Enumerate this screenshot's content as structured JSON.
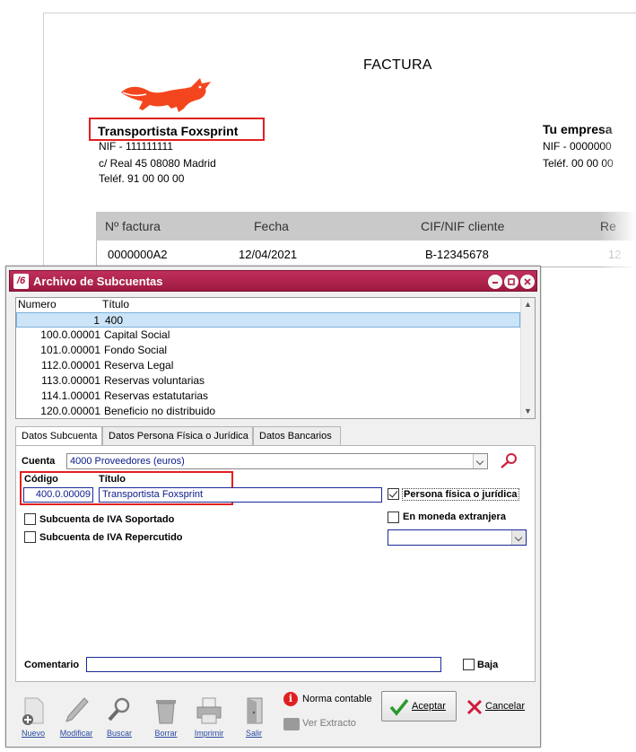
{
  "invoice": {
    "title": "FACTURA",
    "issuer": {
      "name": "Transportista Foxsprint",
      "nif": "NIF - 111111111",
      "address": "c/ Real 45 08080 Madrid",
      "phone": "Teléf. 91 00 00 00"
    },
    "client": {
      "name": "Tu empresa",
      "nif": "NIF - 0000000",
      "phone": "Teléf. 00 00 00"
    },
    "table": {
      "headers": [
        "Nº factura",
        "Fecha",
        "CIF/NIF cliente",
        "Re"
      ],
      "row": [
        "0000000A2",
        "12/04/2021",
        "B-12345678",
        "12"
      ]
    },
    "colors": {
      "fox": "#f4461e",
      "highlight": "#e02020"
    }
  },
  "dialog": {
    "title": "Archivo de Subcuentas",
    "app_icon": "/6",
    "colors": {
      "titlebar": "#b02452"
    },
    "list": {
      "headers": {
        "numero": "Numero",
        "titulo": "Título"
      },
      "rows": [
        {
          "numero": "1",
          "titulo": "400",
          "selected": true
        },
        {
          "numero": "100.0.00001",
          "titulo": "Capital Social"
        },
        {
          "numero": "101.0.00001",
          "titulo": "Fondo Social"
        },
        {
          "numero": "112.0.00001",
          "titulo": "Reserva Legal"
        },
        {
          "numero": "113.0.00001",
          "titulo": "Reservas voluntarias"
        },
        {
          "numero": "114.1.00001",
          "titulo": "Reservas estatutarias"
        },
        {
          "numero": "120.0.00001",
          "titulo": "Beneficio no distribuido"
        }
      ]
    },
    "tabs": [
      "Datos Subcuenta",
      "Datos Persona Física o Jurídica",
      "Datos Bancarios"
    ],
    "form": {
      "cuenta_label": "Cuenta",
      "cuenta_value": "4000  Proveedores (euros)",
      "codigo_label": "Código",
      "codigo_value": "400.0.00009",
      "titulo_label": "Título",
      "titulo_value": "Transportista Foxsprint",
      "persona_label": "Persona física o jurídica",
      "persona_checked": true,
      "iva_soportado_label": "Subcuenta de IVA Soportado",
      "iva_repercutido_label": "Subcuenta de IVA Repercutido",
      "moneda_label": "En moneda extranjera",
      "comentario_label": "Comentario",
      "comentario_value": "",
      "baja_label": "Baja"
    },
    "toolbar": {
      "nuevo": "Nuevo",
      "modificar": "Modificar",
      "buscar": "Buscar",
      "borrar": "Borrar",
      "imprimir": "Imprimir",
      "salir": "Salir",
      "norma_contable": "Norma contable",
      "ver_extracto": "Ver Extracto",
      "aceptar": "Aceptar",
      "cancelar": "Cancelar"
    }
  }
}
